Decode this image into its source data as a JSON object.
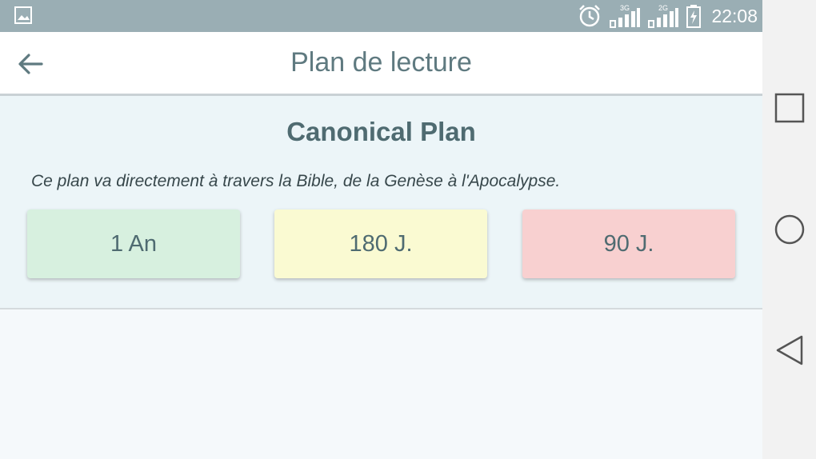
{
  "status_bar": {
    "time": "22:08",
    "network_label_1": "3G",
    "network_label_2": "2G",
    "icons": [
      "image-icon",
      "alarm-icon",
      "signal-icon",
      "signal-icon",
      "battery-icon"
    ]
  },
  "app_bar": {
    "title": "Plan de lecture",
    "back_icon": "arrow-left-icon"
  },
  "plan": {
    "title": "Canonical Plan",
    "description": "Ce plan va directement à travers la Bible, de la Genèse à l'Apocalypse.",
    "options": [
      {
        "label": "1 An",
        "color": "#d7f0df"
      },
      {
        "label": "180 J.",
        "color": "#fafad2"
      },
      {
        "label": "90 J.",
        "color": "#f8d0d0"
      }
    ]
  },
  "nav_bar": {
    "buttons": [
      "recents-square-icon",
      "home-circle-icon",
      "back-triangle-icon"
    ]
  },
  "colors": {
    "status_bar": "#9aaeb4",
    "accent_text": "#4f6b71",
    "background": "#f5f9fb"
  }
}
